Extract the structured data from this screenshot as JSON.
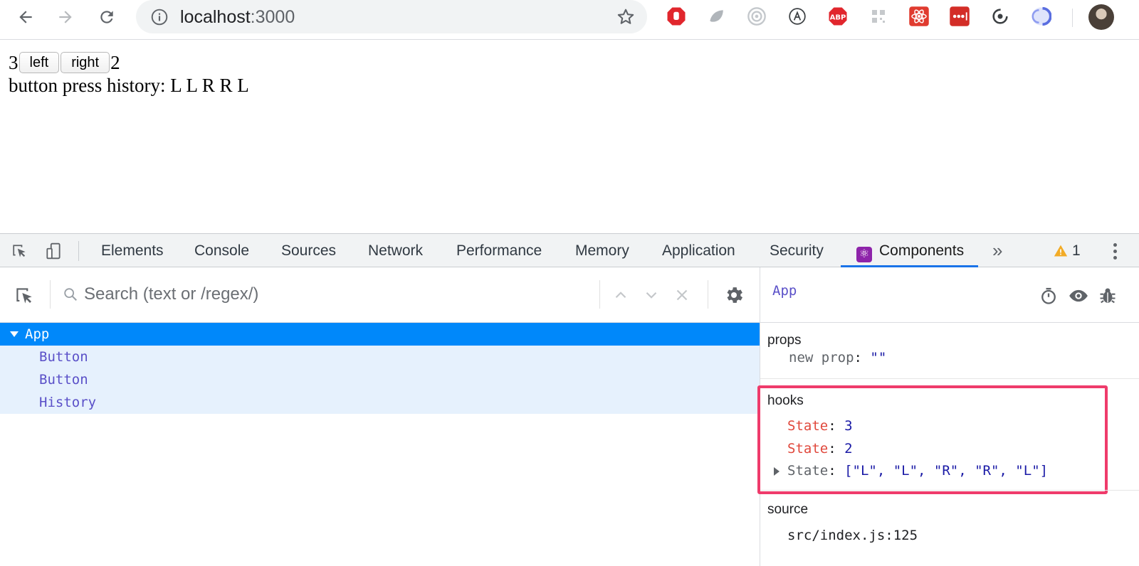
{
  "browser": {
    "url_host": "localhost",
    "url_port": ":3000",
    "icons": [
      "back-arrow-icon",
      "forward-arrow-icon",
      "reload-icon",
      "info-icon",
      "bookmark-star-icon"
    ],
    "extensions": [
      {
        "name": "stop-hand-extension-icon",
        "color": "#e1262d"
      },
      {
        "name": "grey-leaf-extension-icon",
        "color": "#b0b5ba"
      },
      {
        "name": "target-extension-icon",
        "color": "#c4c8cc"
      },
      {
        "name": "accessibility-a-extension-icon",
        "color": "#3c4043"
      },
      {
        "name": "abp-extension-icon",
        "color": "#e1262d",
        "label": "ABP"
      },
      {
        "name": "qr-extension-icon",
        "color": "#c6c9cc"
      },
      {
        "name": "react-red-extension-icon",
        "color": "#e03b2f"
      },
      {
        "name": "lastpass-extension-icon",
        "color": "#d32d27"
      },
      {
        "name": "sync-extension-icon",
        "color": "#3c4043"
      },
      {
        "name": "blue-circle-extension-icon",
        "color": "#5a6ee0"
      }
    ]
  },
  "page": {
    "left_count": "3",
    "left_button": "left",
    "right_button": "right",
    "right_count": "2",
    "history_text": "button press history: L L R R L"
  },
  "devtools": {
    "tabs": [
      {
        "label": "Elements"
      },
      {
        "label": "Console"
      },
      {
        "label": "Sources"
      },
      {
        "label": "Network"
      },
      {
        "label": "Performance"
      },
      {
        "label": "Memory"
      },
      {
        "label": "Application"
      },
      {
        "label": "Security"
      },
      {
        "label": "Components",
        "active": true
      }
    ],
    "more_label": "»",
    "warning_count": "1",
    "accent_color": "#1a73e8"
  },
  "components": {
    "search_placeholder": "Search (text or /regex/)",
    "tree": [
      {
        "label": "App",
        "selected": true
      },
      {
        "label": "Button"
      },
      {
        "label": "Button"
      },
      {
        "label": "History"
      }
    ],
    "selected_title": "App",
    "props_label": "props",
    "new_prop_key": "new prop",
    "new_prop_value": "\"\"",
    "hooks_label": "hooks",
    "hooks": [
      {
        "key": "State",
        "value": "3"
      },
      {
        "key": "State",
        "value": "2"
      },
      {
        "key": "State",
        "value": "[\"L\", \"L\", \"R\", \"R\", \"L\"]"
      }
    ],
    "highlight_color": "#ef3b6b",
    "source_label": "source",
    "source_value": "src/index.js:125"
  }
}
